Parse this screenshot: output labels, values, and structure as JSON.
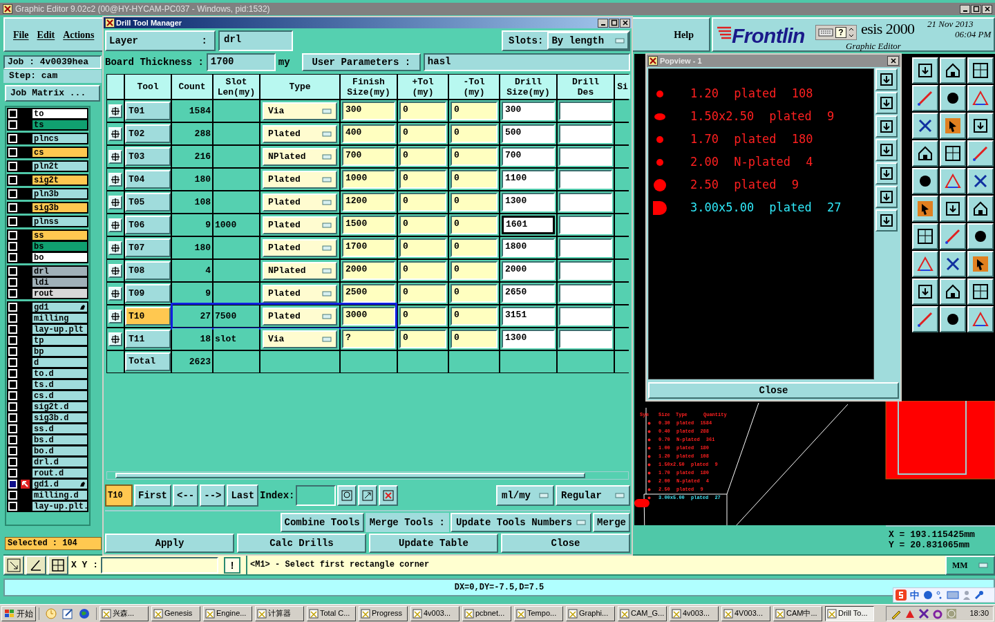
{
  "window": {
    "title": "Graphic Editor 9.02c2 (00@HY-HYCAM-PC037 - Windows, pid:1532)"
  },
  "menu": [
    "File",
    "Edit",
    "Actions",
    "Help"
  ],
  "logo": {
    "brand": "Frontlin",
    "product": "esis 2000",
    "subtitle": "Graphic Editor",
    "date": "21 Nov 2013",
    "time": "06:04 PM"
  },
  "floating_toolbar": {
    "help": "?"
  },
  "job": {
    "job": "Job : 4v0039hea",
    "step": "Step: cam",
    "matrix_button": "Job Matrix ..."
  },
  "layer_groups": [
    {
      "layers": [
        {
          "name": "to",
          "color": "#ffffff",
          "checked": false
        },
        {
          "name": "ts",
          "color": "#10a070",
          "checked": false
        }
      ]
    },
    {
      "layers": [
        {
          "name": "plncs",
          "color": "#a0dcdc",
          "checked": false
        }
      ]
    },
    {
      "layers": [
        {
          "name": "cs",
          "color": "#ffc850",
          "checked": false
        }
      ]
    },
    {
      "layers": [
        {
          "name": "pln2t",
          "color": "#a0dcdc",
          "checked": false
        }
      ]
    },
    {
      "layers": [
        {
          "name": "sig2t",
          "color": "#ffc850",
          "checked": false
        }
      ]
    },
    {
      "layers": [
        {
          "name": "pln3b",
          "color": "#a0dcdc",
          "checked": false
        }
      ]
    },
    {
      "layers": [
        {
          "name": "sig3b",
          "color": "#ffc850",
          "checked": false
        }
      ]
    },
    {
      "layers": [
        {
          "name": "plnss",
          "color": "#a0dcdc",
          "checked": false
        }
      ]
    },
    {
      "layers": [
        {
          "name": "ss",
          "color": "#ffc850",
          "checked": false
        },
        {
          "name": "bs",
          "color": "#10a070",
          "checked": false
        },
        {
          "name": "bo",
          "color": "#ffffff",
          "checked": false
        }
      ]
    },
    {
      "layers": [
        {
          "name": "drl",
          "color": "#a0b0b8",
          "checked": false
        },
        {
          "name": "ldi",
          "color": "#a0b0b8",
          "checked": false
        },
        {
          "name": "rout",
          "color": "#d8d8d8",
          "checked": false
        }
      ]
    },
    {
      "layers": [
        {
          "name": "gd1",
          "color": "#a0dcdc",
          "checked": false,
          "pinned": true
        },
        {
          "name": "milling",
          "color": "#a0dcdc",
          "checked": false
        },
        {
          "name": "lay-up.plt",
          "color": "#a0dcdc",
          "checked": false
        },
        {
          "name": "tp",
          "color": "#a0dcdc",
          "checked": false
        },
        {
          "name": "bp",
          "color": "#a0dcdc",
          "checked": false
        },
        {
          "name": "d",
          "color": "#a0dcdc",
          "checked": false
        },
        {
          "name": "to.d",
          "color": "#a0dcdc",
          "checked": false
        },
        {
          "name": "ts.d",
          "color": "#a0dcdc",
          "checked": false
        },
        {
          "name": "cs.d",
          "color": "#a0dcdc",
          "checked": false
        },
        {
          "name": "sig2t.d",
          "color": "#a0dcdc",
          "checked": false
        },
        {
          "name": "sig3b.d",
          "color": "#a0dcdc",
          "checked": false
        },
        {
          "name": "ss.d",
          "color": "#a0dcdc",
          "checked": false
        },
        {
          "name": "bs.d",
          "color": "#a0dcdc",
          "checked": false
        },
        {
          "name": "bo.d",
          "color": "#a0dcdc",
          "checked": false
        },
        {
          "name": "drl.d",
          "color": "#a0dcdc",
          "checked": false
        },
        {
          "name": "rout.d",
          "color": "#a0dcdc",
          "checked": false
        },
        {
          "name": "gd1.d",
          "color": "#a0dcdc",
          "checked": true,
          "pinned": true
        },
        {
          "name": "milling.d",
          "color": "#a0dcdc",
          "checked": false
        },
        {
          "name": "lay-up.plt.",
          "color": "#a0dcdc",
          "checked": false
        }
      ]
    }
  ],
  "selected_count": "Selected : 104",
  "dialog": {
    "title": "Drill Tool Manager",
    "layer_label": "Layer",
    "layer_colon": ":",
    "layer": "drl",
    "slots_label": "Slots:",
    "slots": "By length",
    "thickness_label": "Board Thickness :",
    "thickness": "1700",
    "thickness_unit": "my",
    "user_params_label": "User Parameters :",
    "user_params": "hasl",
    "columns": [
      "Tool",
      "Count",
      "Slot\nLen(my)",
      "Type",
      "Finish\nSize(my)",
      "+Tol\n(my)",
      "-Tol\n(my)",
      "Drill\nSize(my)",
      "Drill\nDes",
      "Si"
    ],
    "rows": [
      {
        "tool": "T01",
        "count": "1584",
        "type": "Via",
        "finish": "300",
        "plus_tol": "0",
        "minus_tol": "0",
        "drill_size": "300",
        "selected": false,
        "drill_size_focused": false
      },
      {
        "tool": "T02",
        "count": "288",
        "type": "Plated",
        "finish": "400",
        "plus_tol": "0",
        "minus_tol": "0",
        "drill_size": "500",
        "selected": false,
        "drill_size_focused": false
      },
      {
        "tool": "T03",
        "count": "216",
        "type": "NPlated",
        "finish": "700",
        "plus_tol": "0",
        "minus_tol": "0",
        "drill_size": "700",
        "selected": false,
        "drill_size_focused": false
      },
      {
        "tool": "T04",
        "count": "180",
        "type": "Plated",
        "finish": "1000",
        "plus_tol": "0",
        "minus_tol": "0",
        "drill_size": "1100",
        "selected": false,
        "drill_size_focused": false
      },
      {
        "tool": "T05",
        "count": "108",
        "type": "Plated",
        "finish": "1200",
        "plus_tol": "0",
        "minus_tol": "0",
        "drill_size": "1300",
        "selected": false,
        "drill_size_focused": false
      },
      {
        "tool": "T06",
        "count": "9",
        "slot_len": "1000",
        "type": "Plated",
        "finish": "1500",
        "plus_tol": "0",
        "minus_tol": "0",
        "drill_size": "1601",
        "selected": false,
        "drill_size_focused": true
      },
      {
        "tool": "T07",
        "count": "180",
        "type": "Plated",
        "finish": "1700",
        "plus_tol": "0",
        "minus_tol": "0",
        "drill_size": "1800",
        "selected": false,
        "drill_size_focused": false
      },
      {
        "tool": "T08",
        "count": "4",
        "type": "NPlated",
        "finish": "2000",
        "plus_tol": "0",
        "minus_tol": "0",
        "drill_size": "2000",
        "selected": false,
        "drill_size_focused": false
      },
      {
        "tool": "T09",
        "count": "9",
        "type": "Plated",
        "finish": "2500",
        "plus_tol": "0",
        "minus_tol": "0",
        "drill_size": "2650",
        "selected": false,
        "drill_size_focused": false
      },
      {
        "tool": "T10",
        "count": "27",
        "slot_len": "7500",
        "type": "Plated",
        "finish": "3000",
        "plus_tol": "0",
        "minus_tol": "0",
        "drill_size": "3151",
        "selected": true,
        "drill_size_focused": false
      },
      {
        "tool": "T11",
        "count": "18",
        "slot_len": "slot",
        "type": "Via",
        "finish": "?",
        "plus_tol": "0",
        "minus_tol": "0",
        "drill_size": "1300",
        "selected": false,
        "drill_size_focused": false
      }
    ],
    "total": {
      "label": "Total",
      "count": "2623"
    },
    "current_tool": "T10",
    "nav": [
      "First",
      "<--",
      "-->",
      "Last"
    ],
    "index_label": "Index:",
    "units": "ml/my",
    "mode": "Regular",
    "tool_actions": [
      "Combine Tools",
      "Merge Tools :"
    ],
    "renumber": "Update Tools Numbers",
    "merge": "Merge",
    "buttons": [
      "Apply",
      "Calc Drills",
      "Update Table",
      "Close"
    ]
  },
  "popview": {
    "title": "Popview - 1",
    "rows": [
      {
        "text": "1.20 plated 108",
        "kind": "dot",
        "selected": false
      },
      {
        "text": "1.50x2.50 plated 9",
        "kind": "oval",
        "selected": false
      },
      {
        "text": "1.70 plated 180",
        "kind": "dot",
        "selected": false
      },
      {
        "text": "2.00 N-plated 4",
        "kind": "dot",
        "selected": false
      },
      {
        "text": "2.50 plated 9",
        "kind": "circle",
        "selected": false
      },
      {
        "text": "3.00x5.00 plated 27",
        "kind": "slot",
        "selected": true
      }
    ],
    "close": "Close"
  },
  "legend": {
    "header": [
      "Sym",
      "Size",
      "Type",
      "Quantity"
    ],
    "rows": [
      {
        "text": "0.30 plated 1584",
        "selected": false
      },
      {
        "text": "0.40 plated 288",
        "selected": false
      },
      {
        "text": "0.70 N-plated 361",
        "selected": false
      },
      {
        "text": "1.00 plated 180",
        "selected": false
      },
      {
        "text": "1.20 plated 108",
        "selected": false
      },
      {
        "text": "1.50x2.50 plated 9",
        "selected": false
      },
      {
        "text": "1.70 plated 180",
        "selected": false
      },
      {
        "text": "2.00 N-plated 4",
        "selected": false
      },
      {
        "text": "2.50 plated 9",
        "selected": false
      },
      {
        "text": "3.00x5.00 plated 27",
        "selected": true
      }
    ]
  },
  "coords": {
    "x": "X = 193.115425mm",
    "y": "Y = 20.831065mm"
  },
  "command": {
    "xy_label": "X Y :",
    "bang": "!",
    "message": "<M1> - Select first rectangle corner",
    "units": "MM"
  },
  "status": "DX=0,DY=-7.5,D=7.5",
  "ime": {
    "mode": "中"
  },
  "taskbar": {
    "start": "开始",
    "tasks": [
      {
        "label": "兴森...",
        "selected": false
      },
      {
        "label": "Genesis",
        "selected": false
      },
      {
        "label": "Engine...",
        "selected": false
      },
      {
        "label": "计算器",
        "selected": false
      },
      {
        "label": "Total C...",
        "selected": false
      },
      {
        "label": "Progress",
        "selected": false
      },
      {
        "label": "4v003...",
        "selected": false
      },
      {
        "label": "pcbnet...",
        "selected": false
      },
      {
        "label": "Tempo...",
        "selected": false
      },
      {
        "label": "Graphi...",
        "selected": false
      },
      {
        "label": "CAM_G...",
        "selected": false
      },
      {
        "label": "4v003...",
        "selected": false
      },
      {
        "label": "4V003...",
        "selected": false
      },
      {
        "label": "CAM中...",
        "selected": false
      },
      {
        "label": "Drill To...",
        "selected": true
      }
    ],
    "clock": "18:30"
  }
}
